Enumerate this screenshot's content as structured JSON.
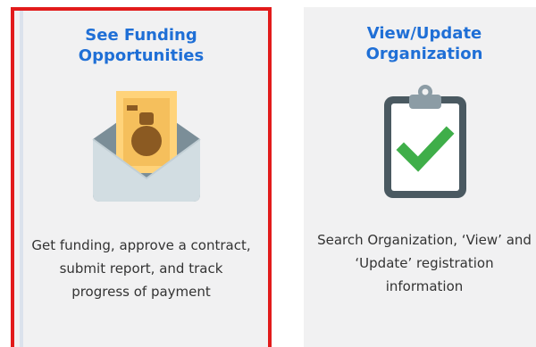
{
  "cards": [
    {
      "title": "See Funding\nOpportunities",
      "description": "Get funding, approve a contract,\nsubmit report, and track\nprogress of payment",
      "icon": "money-envelope-icon",
      "selected": true
    },
    {
      "title": "View/Update\nOrganization",
      "description": "Search Organization, ‘View’ and\n‘Update’ registration\ninformation",
      "icon": "clipboard-check-icon",
      "selected": false
    }
  ],
  "colors": {
    "title": "#1f6fd6",
    "selected_border": "#e21b1b",
    "card_bg": "#f1f1f2"
  }
}
